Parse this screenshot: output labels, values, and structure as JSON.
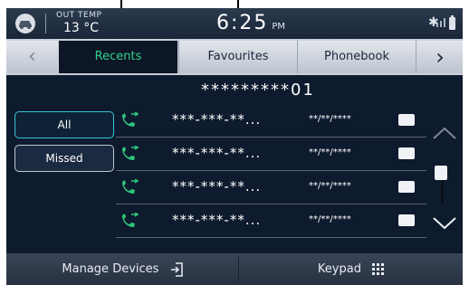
{
  "status_bar": {
    "temp_label": "OUT TEMP",
    "temp_value": "13 °C",
    "time": "6:25",
    "ampm": "PM",
    "icons": [
      "car-icon",
      "bluetooth-icon",
      "signal-icon",
      "battery-icon"
    ]
  },
  "tabs": [
    {
      "label": "",
      "icon": "chevron-left-icon",
      "active": false
    },
    {
      "label": "Recents",
      "active": true
    },
    {
      "label": "Favourites",
      "active": false
    },
    {
      "label": "Phonebook",
      "active": false
    },
    {
      "label": "",
      "icon": "chevron-right-icon",
      "active": false
    }
  ],
  "header_number": "*********01",
  "filters": [
    {
      "label": "All",
      "selected": true
    },
    {
      "label": "Missed",
      "selected": false
    }
  ],
  "calls": [
    {
      "type": "outgoing",
      "number": "***-***-**...",
      "date": "**/**/****",
      "icon": "message-icon"
    },
    {
      "type": "outgoing",
      "number": "***-***-**...",
      "date": "**/**/****",
      "icon": "message-icon"
    },
    {
      "type": "outgoing",
      "number": "***-***-**...",
      "date": "**/**/****",
      "icon": "message-icon"
    },
    {
      "type": "outgoing",
      "number": "***-***-**...",
      "date": "**/**/****",
      "icon": "message-icon"
    }
  ],
  "bottom": {
    "manage_label": "Manage Devices",
    "keypad_label": "Keypad"
  },
  "colors": {
    "active_tab_text": "#33d08a",
    "call_icon": "#2fc77a",
    "background": "#0e1a2e"
  }
}
